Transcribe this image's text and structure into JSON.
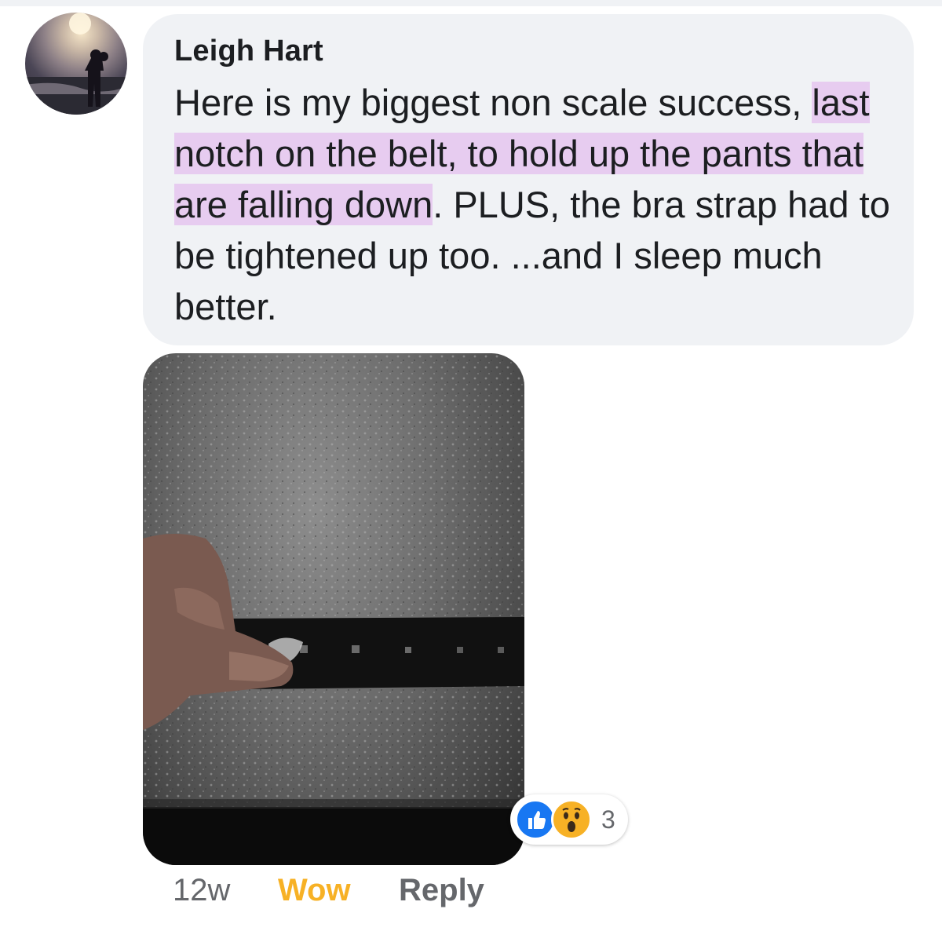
{
  "comment": {
    "author": "Leigh Hart",
    "text_part_1": "Here is my biggest non scale success, ",
    "text_highlight": "last notch on the belt, to hold up the pants that are falling down",
    "text_part_2": ". PLUS, the bra strap had to be tightened up too. ...and I sleep much better.",
    "highlight_color": "#e7ccf0",
    "bubble_color": "#f0f2f5",
    "reactions": {
      "types": [
        "like-icon",
        "wow-icon"
      ],
      "count": "3"
    },
    "actions": {
      "timestamp": "12w",
      "wow_label": "Wow",
      "reply_label": "Reply"
    }
  },
  "colors": {
    "like_blue": "#1877f2",
    "wow_yellow": "#f7b125",
    "secondary_text": "#65676b"
  }
}
